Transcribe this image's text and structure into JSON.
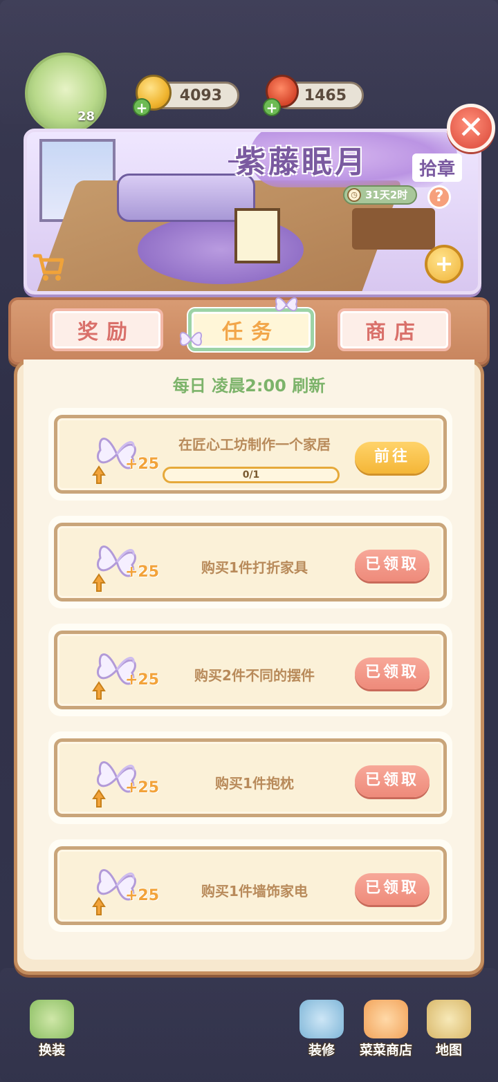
{
  "hud": {
    "level": "28",
    "coins": "4093",
    "veggies": "1465"
  },
  "banner": {
    "title": "紫藤眠月",
    "subtitle": "拾章",
    "timer": "31天2时",
    "help": "?",
    "close": "✕",
    "zoom": "+"
  },
  "tabs": [
    {
      "label": "奖励",
      "active": false
    },
    {
      "label": "任务",
      "active": true
    },
    {
      "label": "商店",
      "active": false
    }
  ],
  "refresh_text": "每日 凌晨2:00 刷新",
  "tasks": [
    {
      "text": "在匠心工坊制作一个家居",
      "reward": "+25",
      "progress": "0/1",
      "progress_fraction": 0,
      "button": "前往",
      "state": "go"
    },
    {
      "text": "购买1件打折家具",
      "reward": "+25",
      "button": "已领取",
      "state": "done"
    },
    {
      "text": "购买2件不同的摆件",
      "reward": "+25",
      "button": "已领取",
      "state": "done"
    },
    {
      "text": "购买1件抱枕",
      "reward": "+25",
      "button": "已领取",
      "state": "done"
    },
    {
      "text": "购买1件墙饰家电",
      "reward": "+25",
      "button": "已领取",
      "state": "done"
    }
  ],
  "bottom_nav": {
    "dress": "换装",
    "decorate": "装修",
    "shop": "菜菜商店",
    "map": "地图"
  },
  "colors": {
    "accent_go": "#f4b637",
    "accent_done": "#ee8a7a",
    "refresh_green": "#7cb36a",
    "panel_border": "#c48d5e"
  }
}
